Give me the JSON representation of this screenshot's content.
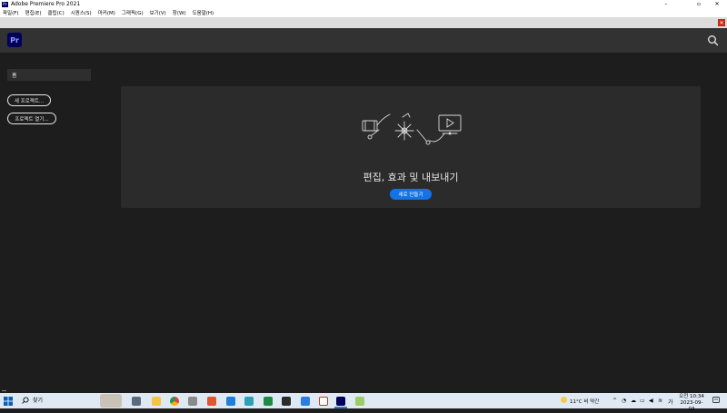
{
  "window": {
    "title": "Adobe Premiere Pro 2021",
    "app_icon_label": "Pr",
    "controls": {
      "minimize": "–",
      "maximize": "▫",
      "close": "✕"
    }
  },
  "menu": {
    "items": [
      "파일(F)",
      "편집(E)",
      "클립(C)",
      "시퀀스(S)",
      "마커(M)",
      "그래픽(G)",
      "보기(V)",
      "창(W)",
      "도움말(H)"
    ]
  },
  "strip_close": "✕",
  "header": {
    "logo": "Pr"
  },
  "sidebar": {
    "home": "홈",
    "new_project": "새 프로젝트...",
    "open_project": "프로젝트 열기..."
  },
  "hero": {
    "title": "편집, 효과 및 내보내기",
    "create_button": "새로 만들기"
  },
  "taskbar": {
    "search_label": "찾기",
    "weather": "11°C 비 약간",
    "time": "오전 10:34",
    "date": "2023-09-03",
    "tray_lang": "가"
  },
  "colors": {
    "accent": "#1473e6",
    "premiere_bg": "#00005b",
    "premiere_fg": "#9999ff",
    "panel_bg": "#1d1d1d",
    "header_bg": "#323232",
    "card_bg": "#2b2b2b"
  }
}
